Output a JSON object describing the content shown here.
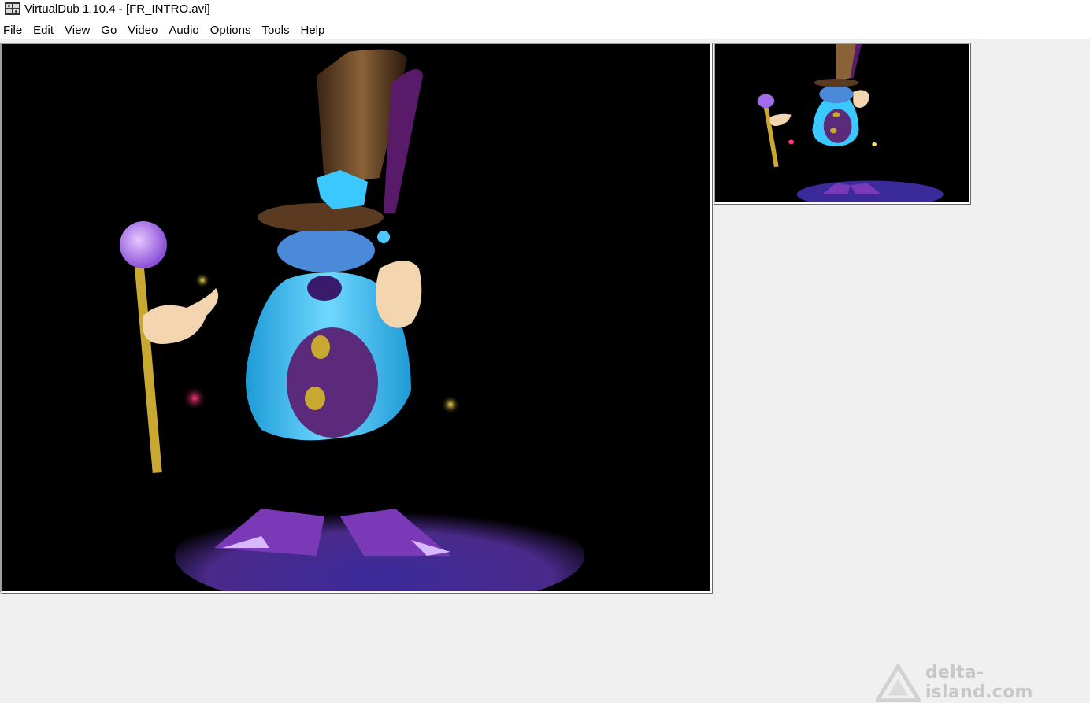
{
  "window": {
    "title": "VirtualDub 1.10.4 - [FR_INTRO.avi]",
    "icon": "virtualdub-film-icon"
  },
  "menu": {
    "items": [
      "File",
      "Edit",
      "View",
      "Go",
      "Video",
      "Audio",
      "Options",
      "Tools",
      "Help"
    ]
  },
  "panes": {
    "input": {
      "content": "video-frame-magician"
    },
    "output": {
      "content": "video-frame-magician-filtered"
    }
  },
  "watermark": {
    "text": "delta-island.com",
    "icon": "triangle-logo-icon"
  },
  "colors": {
    "frame_background": "#000000",
    "workspace": "#f0f0f0",
    "hat": "#5a3b22",
    "hair": "#2fb8e8",
    "body": "#5b2a7a",
    "feet": "#6a3aa8"
  }
}
